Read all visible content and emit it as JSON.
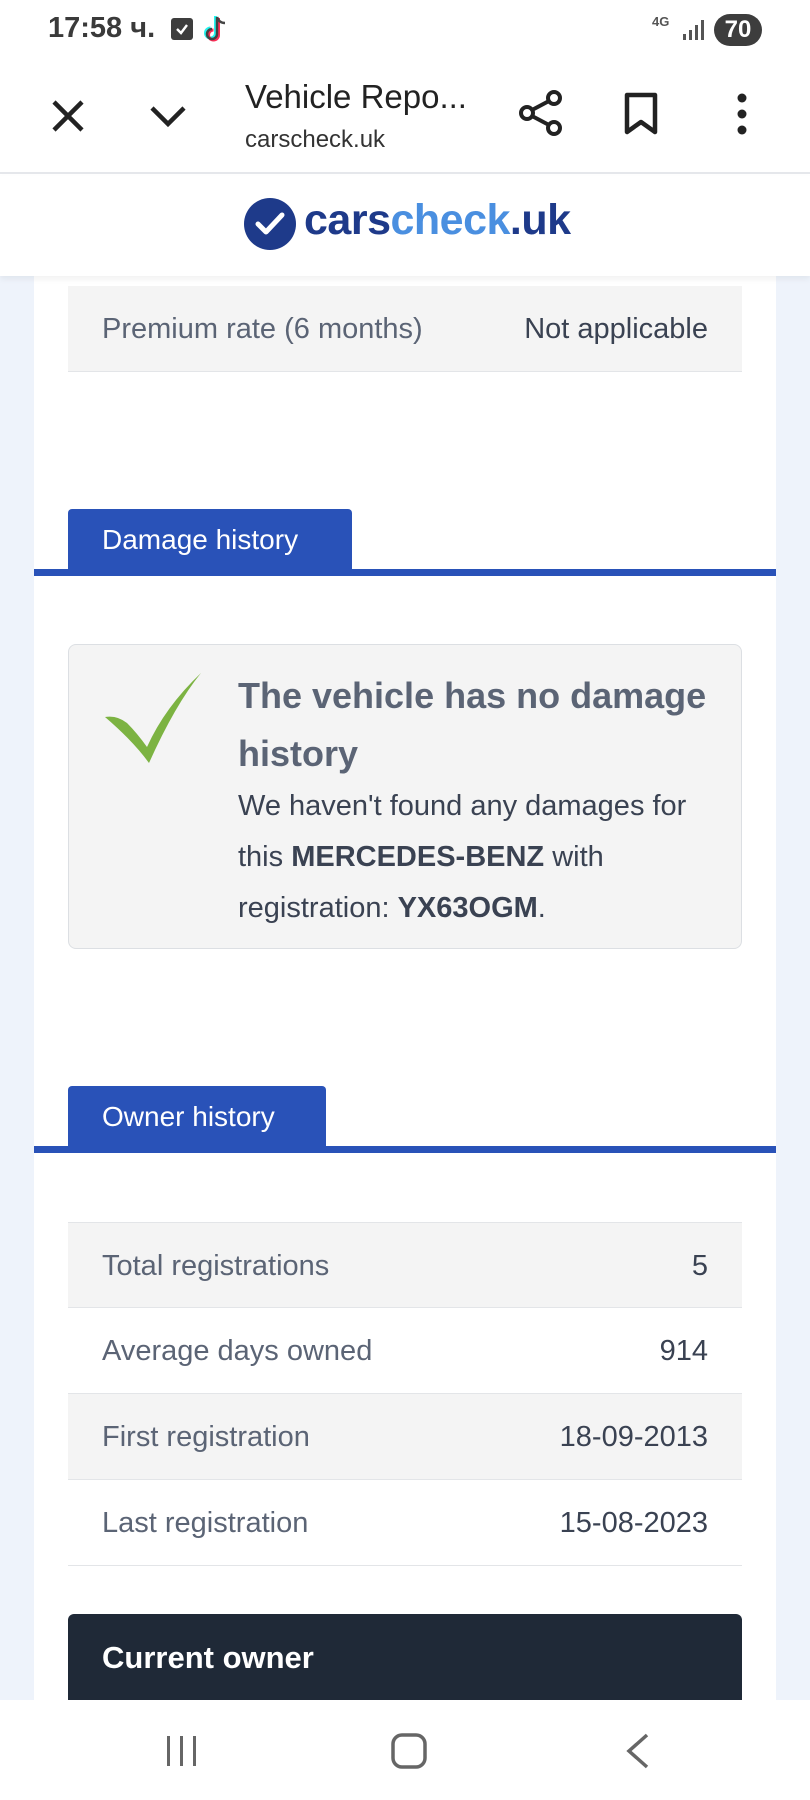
{
  "status_bar": {
    "time": "17:58 ч.",
    "network": "4G",
    "battery": "70"
  },
  "browser": {
    "title": "Vehicle Repo...",
    "url": "carscheck.uk"
  },
  "site": {
    "logo_part1": "cars",
    "logo_part2": "check",
    "logo_part3": ".uk",
    "brand_colors": {
      "dark": "#1e3a8a",
      "light": "#4a8fe0"
    }
  },
  "premium_row": {
    "label": "Premium rate (6 months)",
    "value": "Not applicable"
  },
  "damage_history": {
    "tab_label": "Damage history",
    "title": "The vehicle has no damage history",
    "desc_pre": "We haven't found any damages for this ",
    "make": "MERCEDES-BENZ",
    "desc_mid": " with registration: ",
    "registration": "YX63OGM",
    "desc_post": "."
  },
  "owner_history": {
    "tab_label": "Owner history",
    "rows": [
      {
        "label": "Total registrations",
        "value": "5"
      },
      {
        "label": "Average days owned",
        "value": "914"
      },
      {
        "label": "First registration",
        "value": "18-09-2013"
      },
      {
        "label": "Last registration",
        "value": "15-08-2023"
      }
    ]
  },
  "current_owner": {
    "title": "Current owner"
  },
  "colors": {
    "section_blue": "#2952b8",
    "check_green": "#7cb342",
    "owner_bar": "#1f2937"
  }
}
